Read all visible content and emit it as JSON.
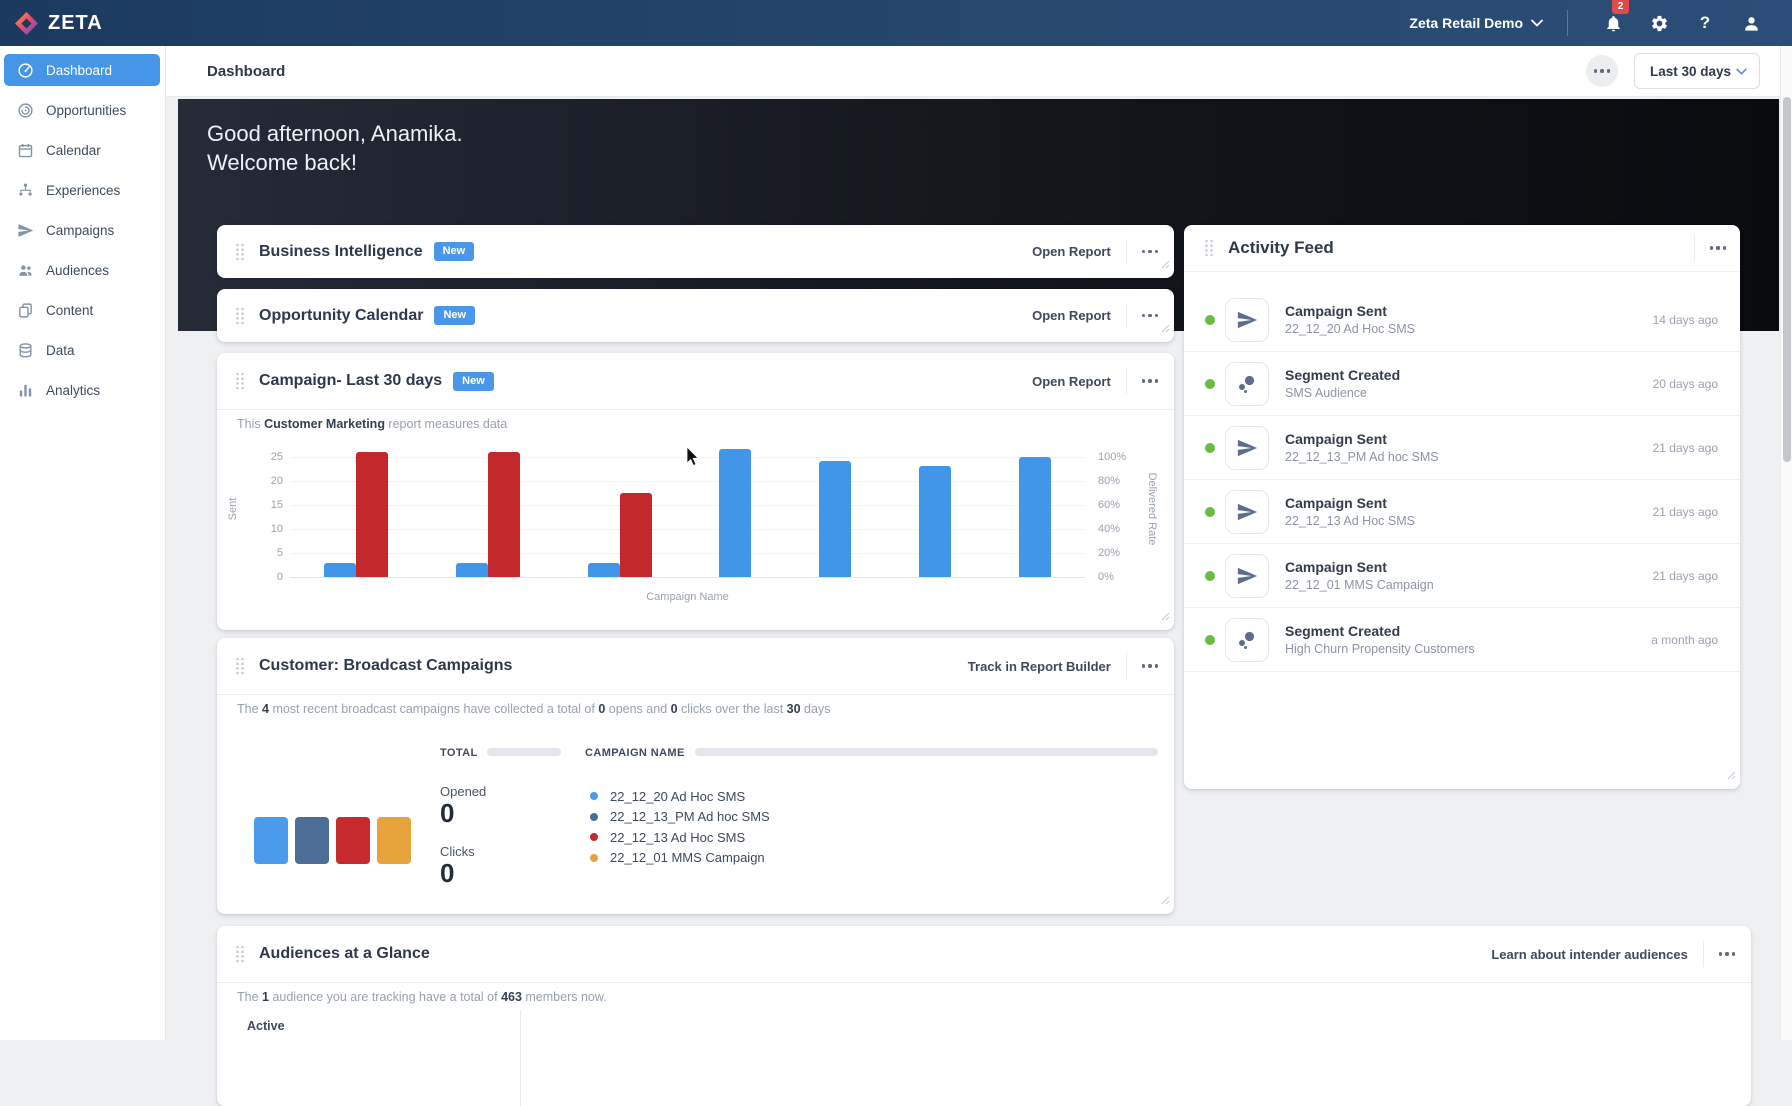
{
  "navbar": {
    "brand": "ZETA",
    "workspace_selector": "Zeta Retail Demo",
    "notification_badge": "2",
    "help_glyph": "?"
  },
  "sidebar": {
    "items": [
      {
        "label": "Dashboard",
        "icon": "dashboard-icon",
        "active": true
      },
      {
        "label": "Opportunities",
        "icon": "opportunities-icon",
        "active": false
      },
      {
        "label": "Calendar",
        "icon": "calendar-icon",
        "active": false
      },
      {
        "label": "Experiences",
        "icon": "experiences-icon",
        "active": false
      },
      {
        "label": "Campaigns",
        "icon": "campaigns-icon",
        "active": false
      },
      {
        "label": "Audiences",
        "icon": "audiences-icon",
        "active": false
      },
      {
        "label": "Content",
        "icon": "content-icon",
        "active": false
      },
      {
        "label": "Data",
        "icon": "data-icon",
        "active": false
      },
      {
        "label": "Analytics",
        "icon": "analytics-icon",
        "active": false
      }
    ]
  },
  "page_header": {
    "title": "Dashboard",
    "date_range": "Last 30 days"
  },
  "hero": {
    "line1": "Good afternoon, Anamika.",
    "line2": "Welcome back!"
  },
  "cards": {
    "business_intelligence": {
      "title": "Business Intelligence",
      "badge": "New",
      "action": "Open Report"
    },
    "opportunity_calendar": {
      "title": "Opportunity Calendar",
      "badge": "New",
      "action": "Open Report"
    },
    "campaign": {
      "title": "Campaign- Last 30 days",
      "badge": "New",
      "action": "Open Report",
      "description_parts": [
        {
          "t": "This "
        },
        {
          "t": "Customer Marketing",
          "b": true
        },
        {
          "t": " report measures data"
        }
      ]
    },
    "broadcast": {
      "title": "Customer: Broadcast Campaigns",
      "action": "Track in Report Builder",
      "summary_parts": [
        {
          "t": "The "
        },
        {
          "t": "4",
          "b": true
        },
        {
          "t": " most recent broadcast campaigns have collected a total of "
        },
        {
          "t": "0",
          "b": true
        },
        {
          "t": " opens and "
        },
        {
          "t": "0",
          "b": true
        },
        {
          "t": " clicks over the last "
        },
        {
          "t": "30",
          "b": true
        },
        {
          "t": " days"
        }
      ],
      "total_label": "TOTAL",
      "campaign_name_label": "CAMPAIGN NAME",
      "opened_label": "Opened",
      "opened_value": "0",
      "clicks_label": "Clicks",
      "clicks_value": "0",
      "swatches": [
        "#4a9ceb",
        "#4c6e96",
        "#c62a2c",
        "#e8a33d"
      ],
      "legend": [
        {
          "color": "#4a9ceb",
          "label": "22_12_20 Ad Hoc SMS"
        },
        {
          "color": "#4c6e96",
          "label": "22_12_13_PM Ad hoc SMS"
        },
        {
          "color": "#c62a2c",
          "label": "22_12_13 Ad Hoc SMS"
        },
        {
          "color": "#e8a33d",
          "label": "22_12_01 MMS Campaign"
        }
      ]
    },
    "audiences": {
      "title": "Audiences at a Glance",
      "action": "Learn about intender audiences",
      "summary_parts": [
        {
          "t": "The "
        },
        {
          "t": "1",
          "b": true
        },
        {
          "t": " audience you are tracking have a total of "
        },
        {
          "t": "463",
          "b": true
        },
        {
          "t": " members now."
        }
      ],
      "active_label": "Active"
    }
  },
  "activity_feed": {
    "title": "Activity Feed",
    "items": [
      {
        "icon": "campaign-sent-icon",
        "title": "Campaign Sent",
        "subtitle": "22_12_20 Ad Hoc SMS",
        "time": "14 days ago"
      },
      {
        "icon": "segment-created-icon",
        "title": "Segment Created",
        "subtitle": "SMS Audience",
        "time": "20 days ago"
      },
      {
        "icon": "campaign-sent-icon",
        "title": "Campaign Sent",
        "subtitle": "22_12_13_PM Ad hoc SMS",
        "time": "21 days ago"
      },
      {
        "icon": "campaign-sent-icon",
        "title": "Campaign Sent",
        "subtitle": "22_12_13 Ad Hoc SMS",
        "time": "21 days ago"
      },
      {
        "icon": "campaign-sent-icon",
        "title": "Campaign Sent",
        "subtitle": "22_12_01 MMS Campaign",
        "time": "21 days ago"
      },
      {
        "icon": "segment-created-icon",
        "title": "Segment Created",
        "subtitle": "High Churn Propensity Customers",
        "time": "a month ago"
      }
    ]
  },
  "chart_data": {
    "type": "bar",
    "title": "Campaign- Last 30 days",
    "xlabel": "Campaign Name",
    "ylabel_left": "Sent",
    "ylabel_right": "Delivered Rate",
    "y_ticks_left": [
      25,
      20,
      15,
      10,
      5,
      0
    ],
    "y_ticks_right": [
      "100%",
      "80%",
      "60%",
      "40%",
      "20%",
      "0%"
    ],
    "ylim": [
      0,
      27
    ],
    "grid": true,
    "legend_position": "none",
    "series_colors": {
      "blue": "#4296ea",
      "red": "#c3282c"
    },
    "groups": [
      {
        "bars": [
          {
            "series": "blue",
            "value": 3
          },
          {
            "series": "red",
            "value": 26
          }
        ]
      },
      {
        "bars": [
          {
            "series": "blue",
            "value": 3
          },
          {
            "series": "red",
            "value": 26
          }
        ]
      },
      {
        "bars": [
          {
            "series": "blue",
            "value": 3
          },
          {
            "series": "red",
            "value": 17.5
          }
        ]
      },
      {
        "bars": [
          {
            "series": "blue",
            "value": 26.5
          }
        ]
      },
      {
        "bars": [
          {
            "series": "blue",
            "value": 24
          }
        ]
      },
      {
        "bars": [
          {
            "series": "blue",
            "value": 23
          }
        ]
      },
      {
        "bars": [
          {
            "series": "blue",
            "value": 25
          }
        ]
      }
    ]
  }
}
